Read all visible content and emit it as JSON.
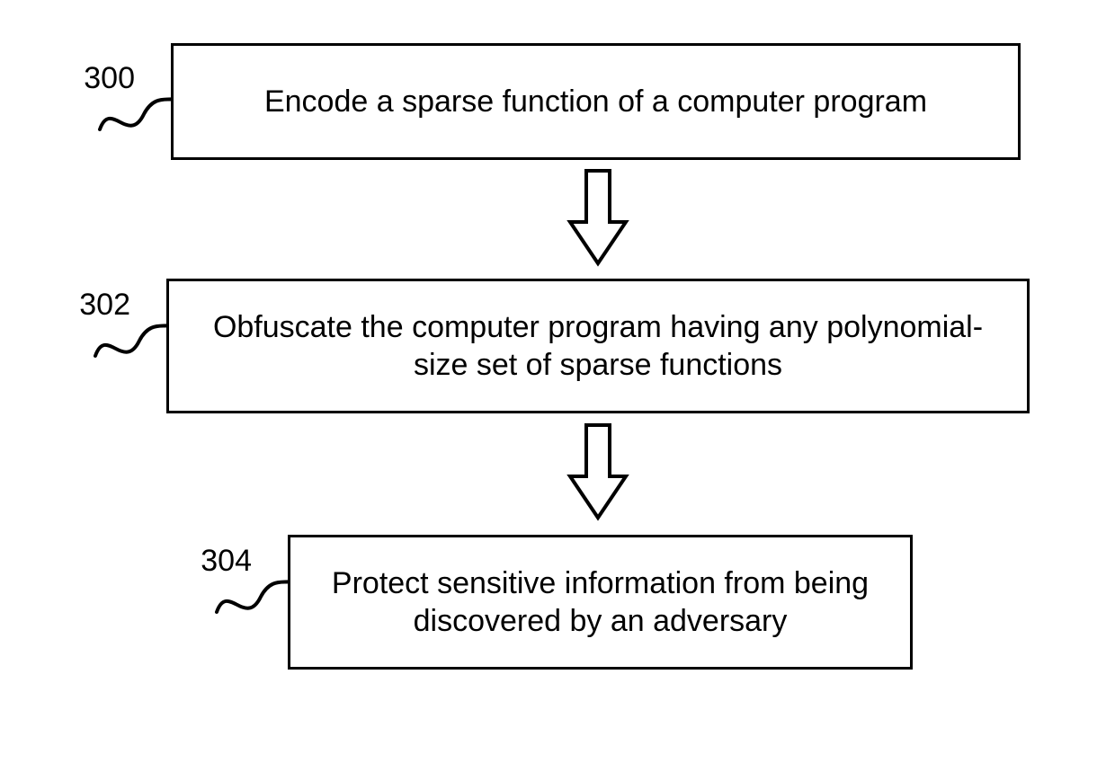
{
  "steps": [
    {
      "ref": "300",
      "text": "Encode a sparse function of a computer program"
    },
    {
      "ref": "302",
      "text": "Obfuscate the computer program having any polynomial-size set of sparse functions"
    },
    {
      "ref": "304",
      "text": "Protect sensitive information from being discovered by an adversary"
    }
  ]
}
